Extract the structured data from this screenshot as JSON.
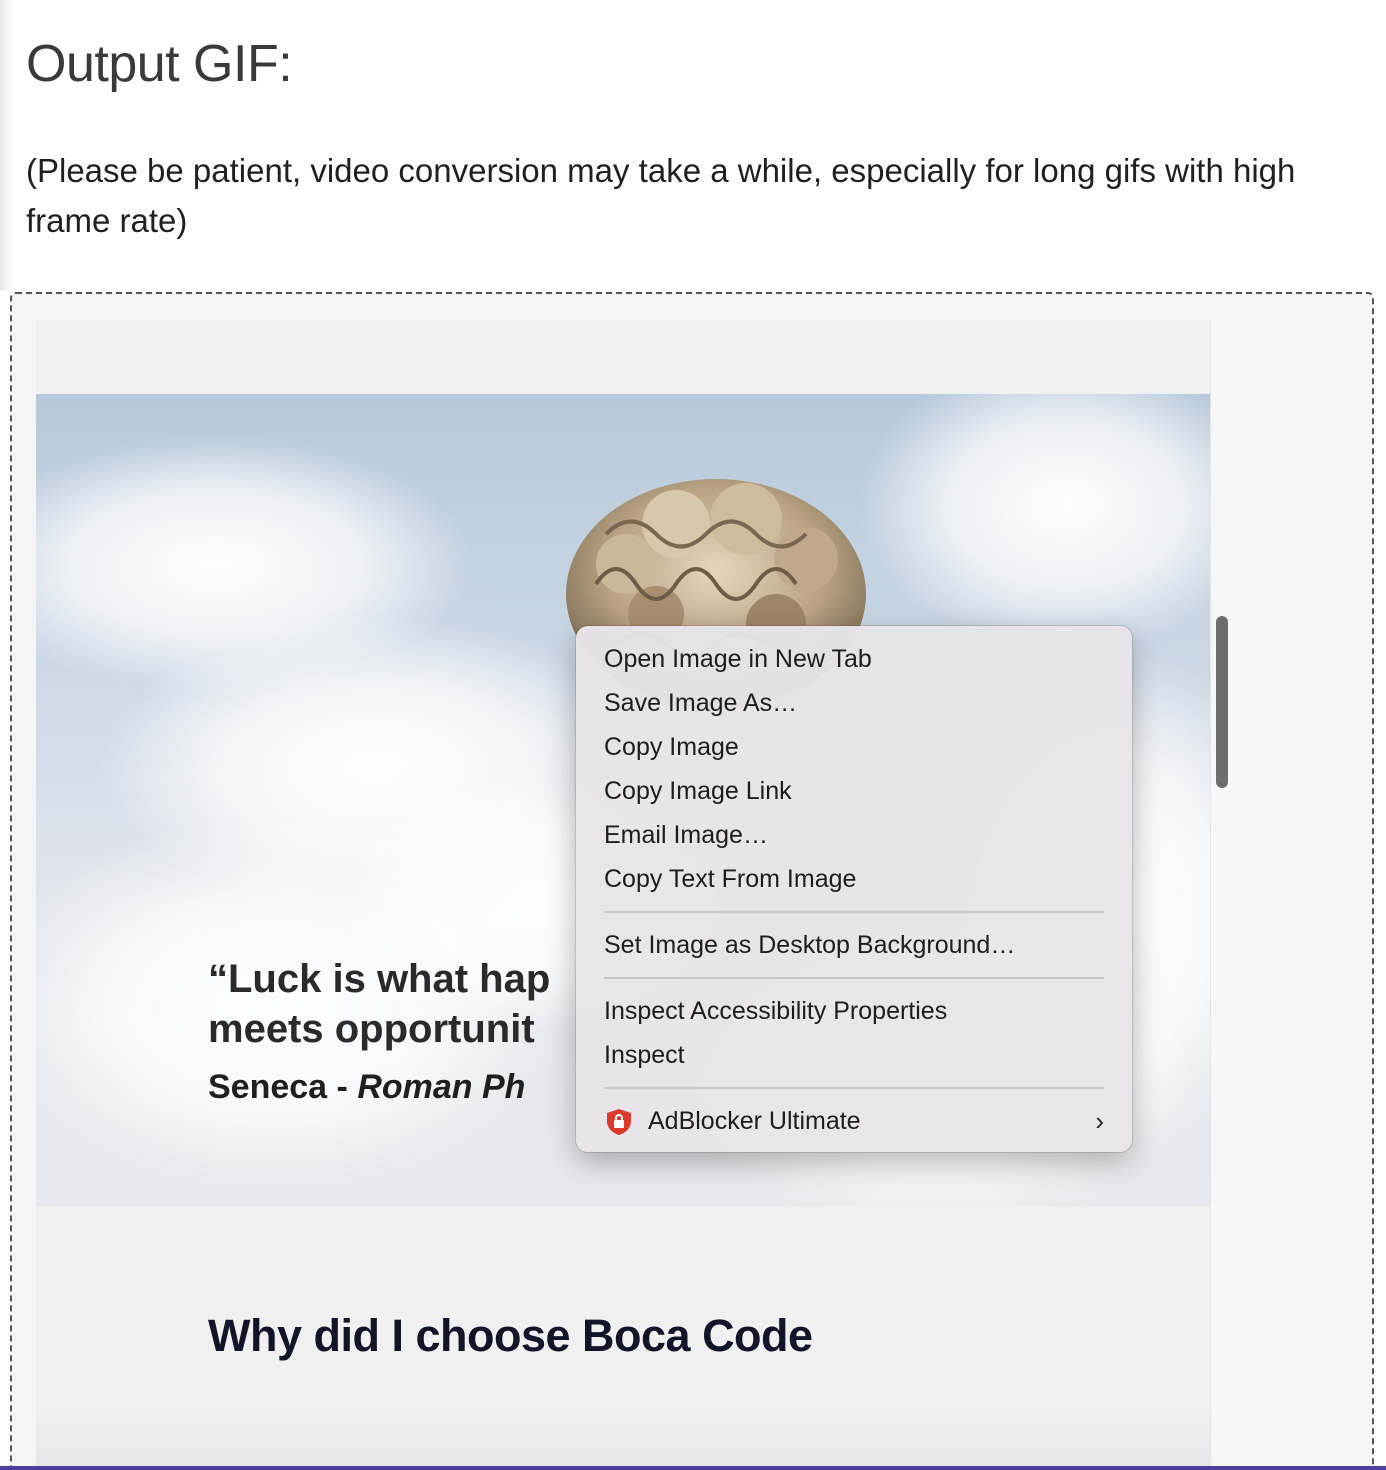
{
  "header": {
    "title": "Output GIF:",
    "note": "(Please be patient, video conversion may take a while, especially for long gifs with high frame rate)"
  },
  "gif": {
    "quote_line1": "“Luck is what hap",
    "quote_line2": "meets opportunit",
    "author_name": "Seneca - ",
    "author_role": "Roman Ph",
    "section_title": "Why did I choose Boca Code"
  },
  "context_menu": {
    "items": [
      "Open Image in New Tab",
      "Save Image As…",
      "Copy Image",
      "Copy Image Link",
      "Email Image…",
      "Copy Text From Image"
    ],
    "desktop_item": "Set Image as Desktop Background…",
    "inspect_items": [
      "Inspect Accessibility Properties",
      "Inspect"
    ],
    "extension_item": "AdBlocker Ultimate",
    "extension_icon": "shield-lock-icon",
    "submenu_icon": "chevron-right-icon"
  },
  "colors": {
    "accent_line": "#4b3fa0",
    "shield_red": "#d93a2b"
  }
}
